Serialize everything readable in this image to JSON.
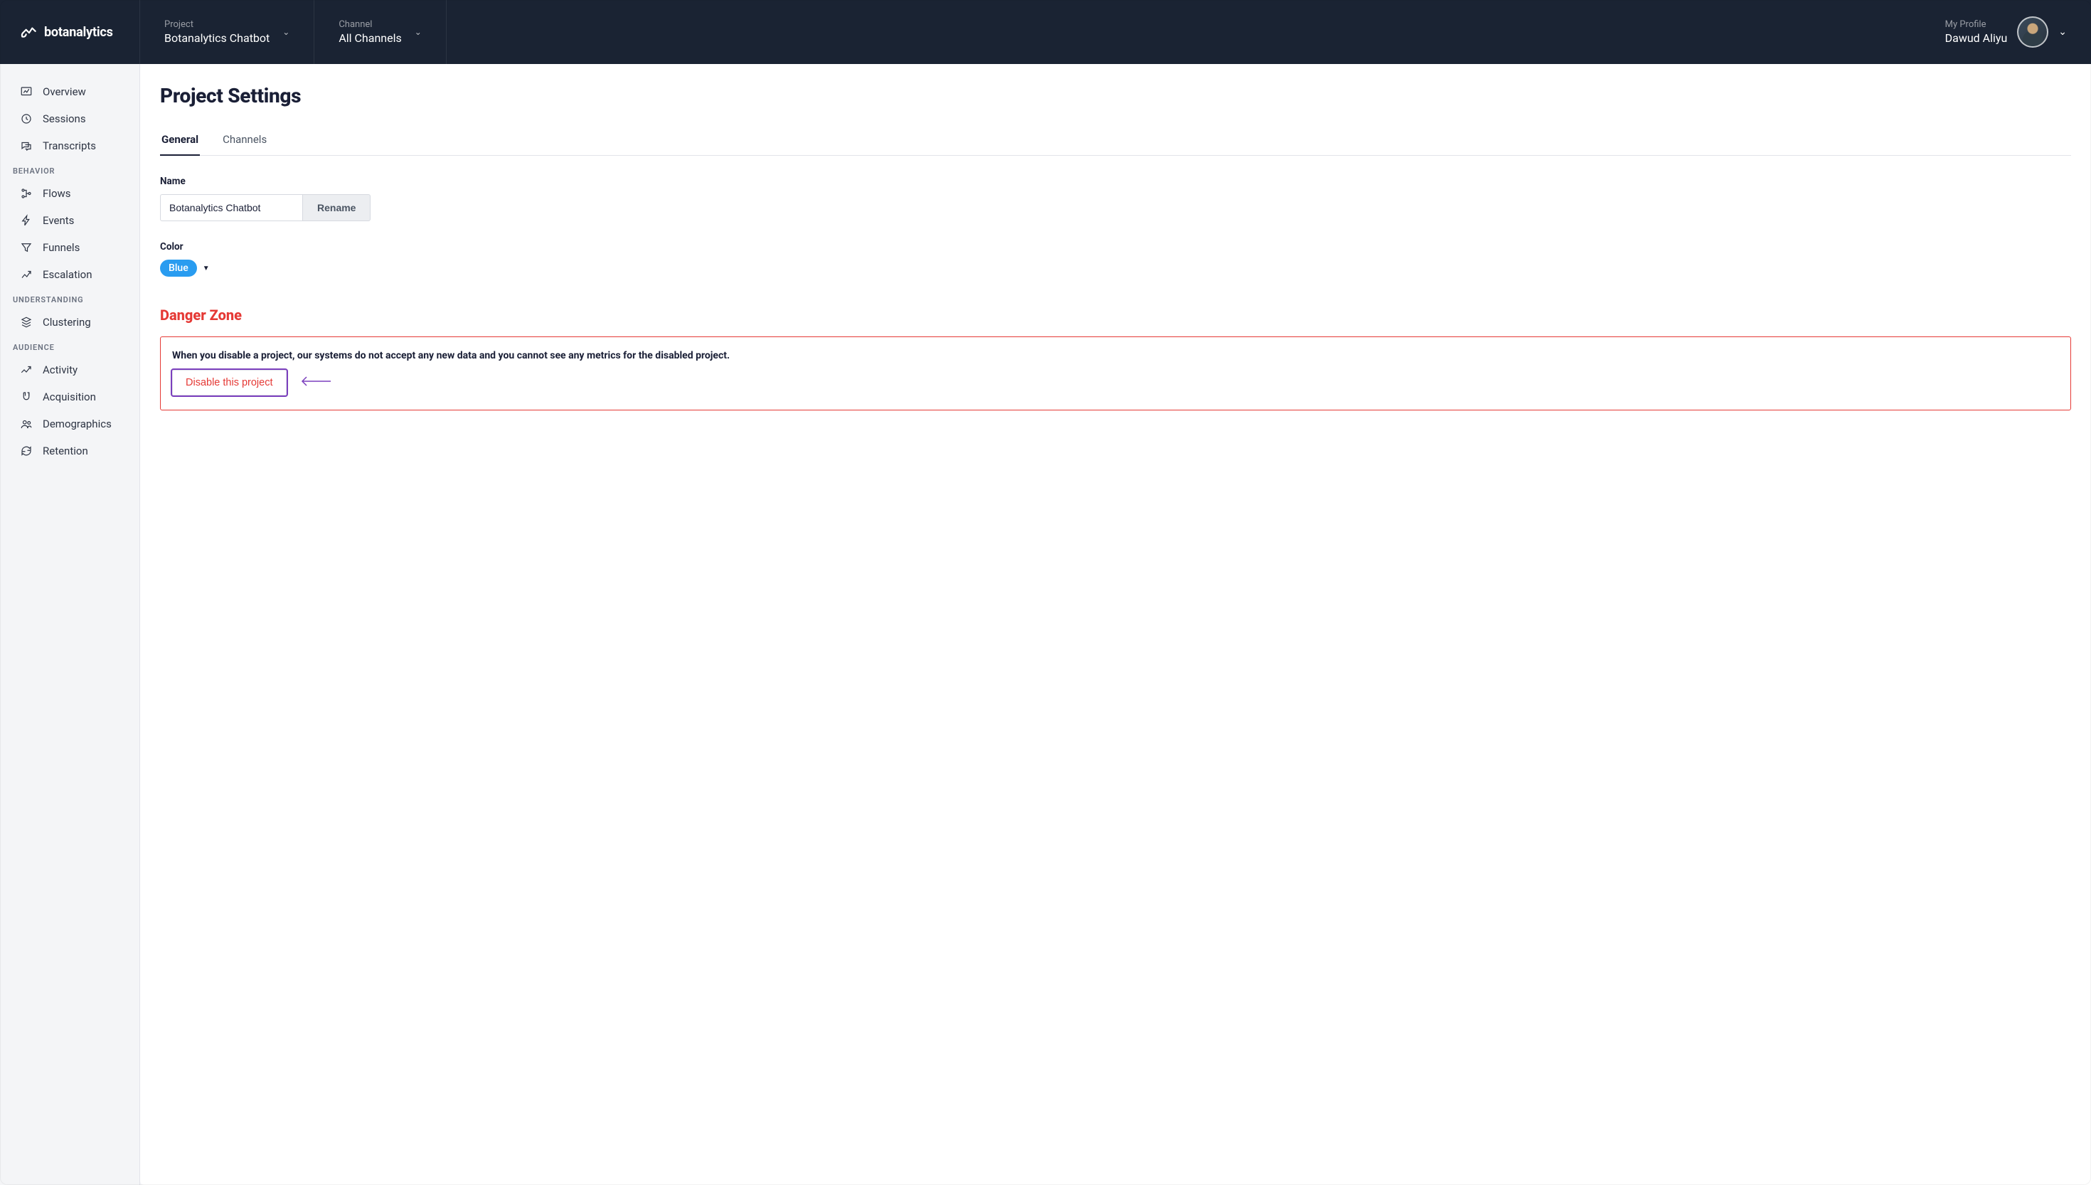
{
  "brand": {
    "name": "botanalytics"
  },
  "header": {
    "project": {
      "label": "Project",
      "value": "Botanalytics Chatbot"
    },
    "channel": {
      "label": "Channel",
      "value": "All Channels"
    },
    "profile": {
      "label": "My Profile",
      "value": "Dawud Aliyu"
    }
  },
  "sidebar": {
    "top": [
      {
        "label": "Overview"
      },
      {
        "label": "Sessions"
      },
      {
        "label": "Transcripts"
      }
    ],
    "sections": [
      {
        "title": "BEHAVIOR",
        "items": [
          {
            "label": "Flows"
          },
          {
            "label": "Events"
          },
          {
            "label": "Funnels"
          },
          {
            "label": "Escalation"
          }
        ]
      },
      {
        "title": "UNDERSTANDING",
        "items": [
          {
            "label": "Clustering"
          }
        ]
      },
      {
        "title": "AUDIENCE",
        "items": [
          {
            "label": "Activity"
          },
          {
            "label": "Acquisition"
          },
          {
            "label": "Demographics"
          },
          {
            "label": "Retention"
          }
        ]
      }
    ]
  },
  "page": {
    "title": "Project Settings",
    "tabs": {
      "general": "General",
      "channels": "Channels"
    },
    "name_label": "Name",
    "name_value": "Botanalytics Chatbot",
    "rename": "Rename",
    "color_label": "Color",
    "color_value": "Blue",
    "danger_zone_title": "Danger Zone",
    "danger_zone_msg": "When you disable a project, our systems do not accept any new data and you cannot see any metrics for the disabled project.",
    "disable_btn": "Disable this project"
  }
}
